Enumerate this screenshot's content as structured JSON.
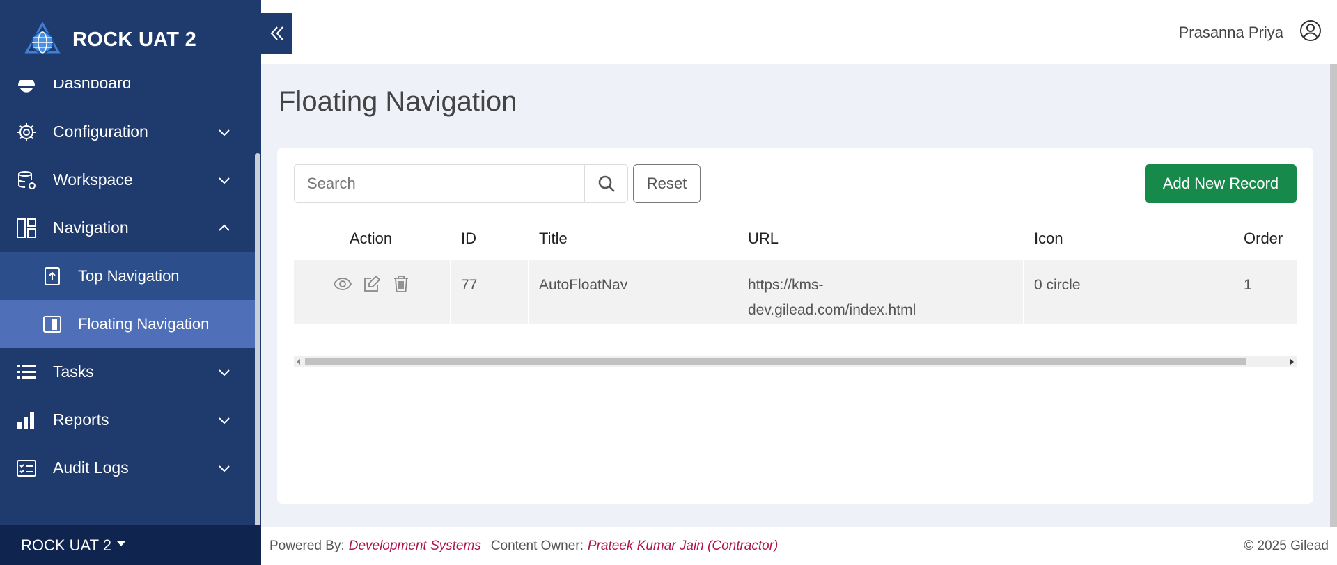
{
  "brand": {
    "title": "ROCK UAT 2"
  },
  "sidebar": {
    "items": [
      {
        "label": "Dashboard",
        "icon": "dashboard-icon"
      },
      {
        "label": "Configuration",
        "icon": "gear-icon"
      },
      {
        "label": "Workspace",
        "icon": "database-icon"
      },
      {
        "label": "Navigation",
        "icon": "layout-icon"
      },
      {
        "label": "Tasks",
        "icon": "list-icon"
      },
      {
        "label": "Reports",
        "icon": "bar-chart-icon"
      },
      {
        "label": "Audit Logs",
        "icon": "checklist-icon"
      }
    ],
    "sub_items": [
      {
        "label": "Top Navigation",
        "icon": "upload-box-icon"
      },
      {
        "label": "Floating Navigation",
        "icon": "sidebar-box-icon"
      }
    ],
    "footer": "ROCK UAT 2"
  },
  "header": {
    "user_name": "Prasanna Priya"
  },
  "page": {
    "title": "Floating Navigation"
  },
  "toolbar": {
    "search_placeholder": "Search",
    "reset_label": "Reset",
    "add_label": "Add New Record"
  },
  "table": {
    "columns": [
      "Action",
      "ID",
      "Title",
      "URL",
      "Icon",
      "Order"
    ],
    "rows": [
      {
        "id": "77",
        "title": "AutoFloatNav",
        "url_line1": "https://kms-",
        "url_line2": "dev.gilead.com/index.html",
        "icon": "0 circle",
        "order": "1"
      }
    ]
  },
  "footer": {
    "powered_label": "Powered By:",
    "powered_value": "Development Systems",
    "owner_label": "Content Owner:",
    "owner_value": "Prateek Kumar Jain (Contractor)",
    "copyright": "© 2025 Gilead"
  },
  "colors": {
    "sidebar": "#1f3b6e",
    "active_sub": "#4f6fb8",
    "add_button": "#178a4b",
    "link": "#b0144f"
  }
}
